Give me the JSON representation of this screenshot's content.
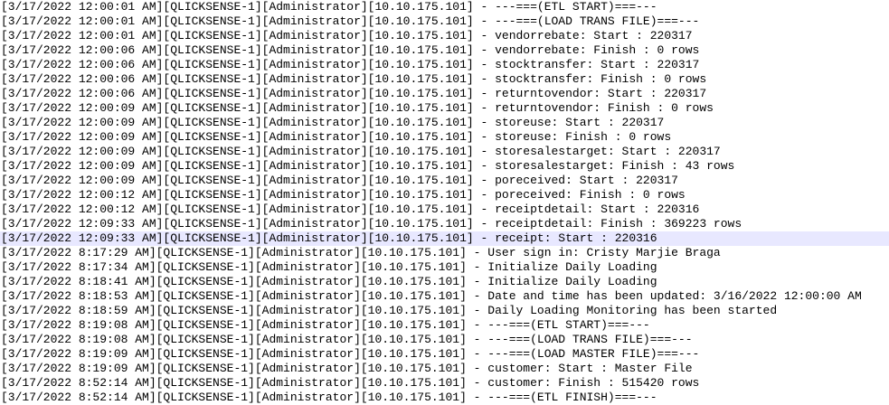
{
  "log": {
    "highlight_color": "#e8e8ff",
    "highlighted_index": 16,
    "lines": [
      "[3/17/2022 12:00:01 AM][QLICKSENSE-1][Administrator][10.10.175.101] - ---===(ETL START)===---",
      "[3/17/2022 12:00:01 AM][QLICKSENSE-1][Administrator][10.10.175.101] - ---===(LOAD TRANS FILE)===---",
      "[3/17/2022 12:00:01 AM][QLICKSENSE-1][Administrator][10.10.175.101] - vendorrebate: Start : 220317",
      "[3/17/2022 12:00:06 AM][QLICKSENSE-1][Administrator][10.10.175.101] - vendorrebate: Finish : 0 rows",
      "[3/17/2022 12:00:06 AM][QLICKSENSE-1][Administrator][10.10.175.101] - stocktransfer: Start : 220317",
      "[3/17/2022 12:00:06 AM][QLICKSENSE-1][Administrator][10.10.175.101] - stocktransfer: Finish : 0 rows",
      "[3/17/2022 12:00:06 AM][QLICKSENSE-1][Administrator][10.10.175.101] - returntovendor: Start : 220317",
      "[3/17/2022 12:00:09 AM][QLICKSENSE-1][Administrator][10.10.175.101] - returntovendor: Finish : 0 rows",
      "[3/17/2022 12:00:09 AM][QLICKSENSE-1][Administrator][10.10.175.101] - storeuse: Start : 220317",
      "[3/17/2022 12:00:09 AM][QLICKSENSE-1][Administrator][10.10.175.101] - storeuse: Finish : 0 rows",
      "[3/17/2022 12:00:09 AM][QLICKSENSE-1][Administrator][10.10.175.101] - storesalestarget: Start : 220317",
      "[3/17/2022 12:00:09 AM][QLICKSENSE-1][Administrator][10.10.175.101] - storesalestarget: Finish : 43 rows",
      "[3/17/2022 12:00:09 AM][QLICKSENSE-1][Administrator][10.10.175.101] - poreceived: Start : 220317",
      "[3/17/2022 12:00:12 AM][QLICKSENSE-1][Administrator][10.10.175.101] - poreceived: Finish : 0 rows",
      "[3/17/2022 12:00:12 AM][QLICKSENSE-1][Administrator][10.10.175.101] - receiptdetail: Start : 220316",
      "[3/17/2022 12:09:33 AM][QLICKSENSE-1][Administrator][10.10.175.101] - receiptdetail: Finish : 369223 rows",
      "[3/17/2022 12:09:33 AM][QLICKSENSE-1][Administrator][10.10.175.101] - receipt: Start : 220316",
      "[3/17/2022 8:17:29 AM][QLICKSENSE-1][Administrator][10.10.175.101] - User sign in: Cristy Marjie Braga",
      "[3/17/2022 8:17:34 AM][QLICKSENSE-1][Administrator][10.10.175.101] - Initialize Daily Loading",
      "[3/17/2022 8:18:41 AM][QLICKSENSE-1][Administrator][10.10.175.101] - Initialize Daily Loading",
      "[3/17/2022 8:18:53 AM][QLICKSENSE-1][Administrator][10.10.175.101] - Date and time has been updated: 3/16/2022 12:00:00 AM",
      "[3/17/2022 8:18:59 AM][QLICKSENSE-1][Administrator][10.10.175.101] - Daily Loading Monitoring has been started",
      "[3/17/2022 8:19:08 AM][QLICKSENSE-1][Administrator][10.10.175.101] - ---===(ETL START)===---",
      "[3/17/2022 8:19:08 AM][QLICKSENSE-1][Administrator][10.10.175.101] - ---===(LOAD TRANS FILE)===---",
      "[3/17/2022 8:19:09 AM][QLICKSENSE-1][Administrator][10.10.175.101] - ---===(LOAD MASTER FILE)===---",
      "[3/17/2022 8:19:09 AM][QLICKSENSE-1][Administrator][10.10.175.101] - customer: Start : Master File",
      "[3/17/2022 8:52:14 AM][QLICKSENSE-1][Administrator][10.10.175.101] - customer: Finish : 515420 rows",
      "[3/17/2022 8:52:14 AM][QLICKSENSE-1][Administrator][10.10.175.101] - ---===(ETL FINISH)===---"
    ]
  }
}
